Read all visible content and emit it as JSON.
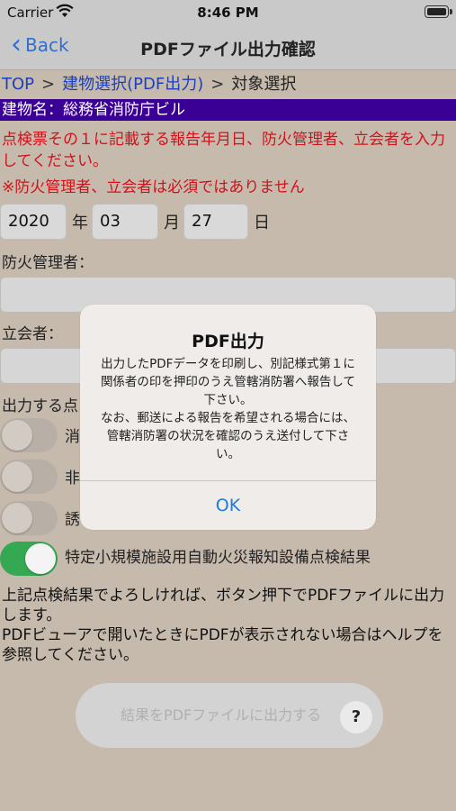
{
  "status_bar": {
    "carrier": "Carrier",
    "time": "8:46 PM"
  },
  "nav": {
    "back_label": "Back",
    "title": "PDFファイル出力確認"
  },
  "breadcrumb": {
    "top": "TOP",
    "sep1": ">",
    "building_select": "建物選択(PDF出力)",
    "sep2": ">",
    "current": "対象選択"
  },
  "building": {
    "label": "建物名：総務省消防庁ビル"
  },
  "instructions": {
    "line1": "点検票その１に記載する報告年月日、防火管理者、立会者を入力してください。",
    "line2": "※防火管理者、立会者は必須ではありません"
  },
  "date": {
    "year": "2020",
    "year_unit": "年",
    "month": "03",
    "month_unit": "月",
    "day": "27",
    "day_unit": "日"
  },
  "fire_manager": {
    "label": "防火管理者：",
    "value": ""
  },
  "witness": {
    "label": "立会者：",
    "value": ""
  },
  "output_items": {
    "label": "出力する点",
    "items": [
      {
        "label": "消",
        "on": false
      },
      {
        "label": "非",
        "on": false
      },
      {
        "label": "誘",
        "on": false
      },
      {
        "label": "特定小規模施設用自動火災報知設備点検結果",
        "on": true
      }
    ]
  },
  "footer_text": {
    "line1": "上記点検結果でよろしければ、ボタン押下でPDFファイルに出力します。",
    "line2": "PDFビューアで開いたときにPDFが表示されない場合はヘルプを参照してください。"
  },
  "output_button": {
    "label": "結果をPDFファイルに出力する",
    "help": "?"
  },
  "alert": {
    "title": "PDF出力",
    "message_p1": "出力したPDFデータを印刷し、別記様式第１に関係者の印を押印のうえ管轄消防署へ報告して下さい。",
    "message_p2": "なお、郵送による報告を希望される場合には、管轄消防署の状況を確認のうえ送付して下さい。",
    "ok": "OK"
  }
}
